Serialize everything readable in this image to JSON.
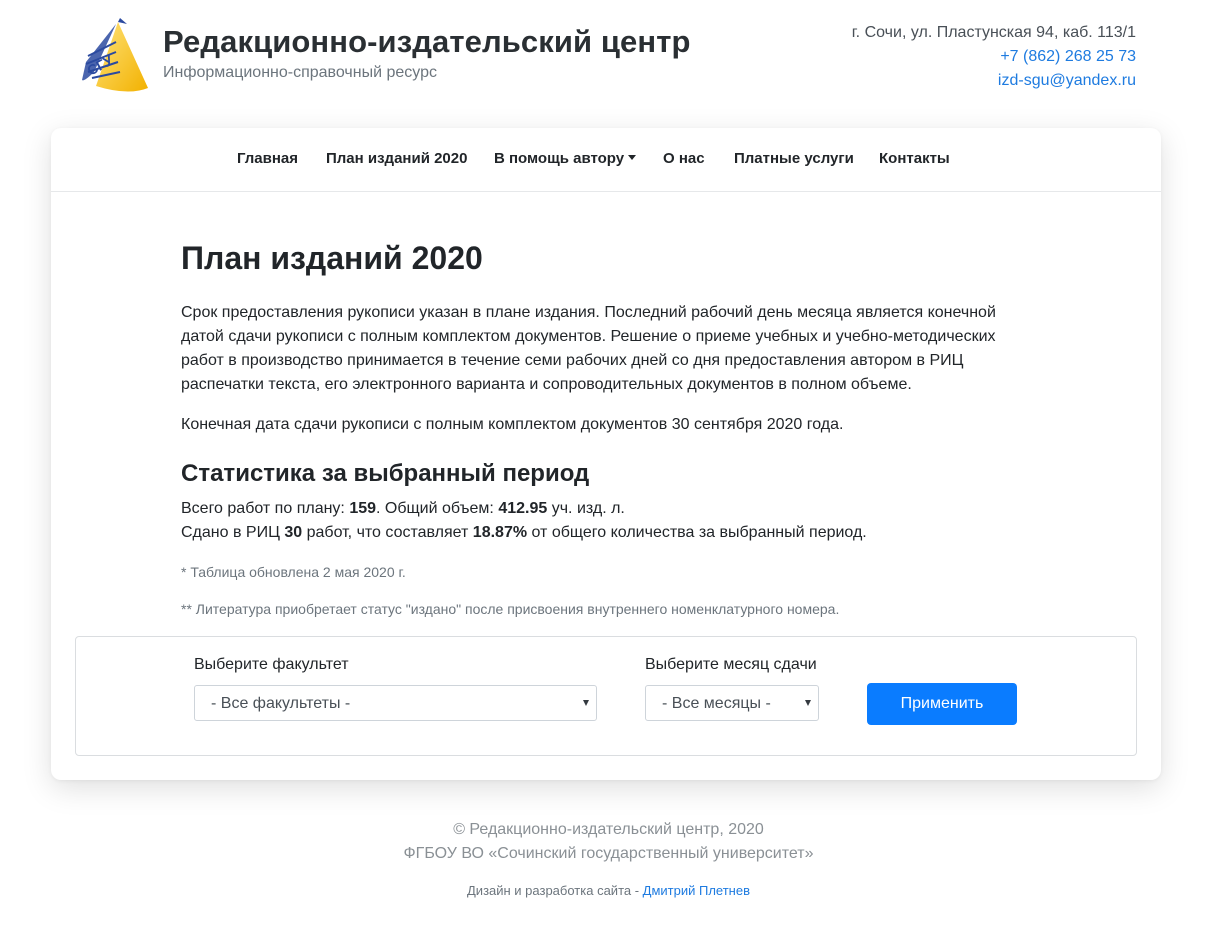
{
  "header": {
    "title": "Редакционно-издательский центр",
    "subtitle": "Информационно-справочный ресурс",
    "logo_text": "СГУ",
    "address": "г. Сочи, ул. Пластунская 94, каб. 113/1",
    "phone": "+7 (862) 268 25 73",
    "email": "izd-sgu@yandex.ru"
  },
  "nav": {
    "items": [
      {
        "label": "Главная"
      },
      {
        "label": "План изданий 2020"
      },
      {
        "label": "В помощь автору"
      },
      {
        "label": "О нас"
      },
      {
        "label": "Платные услуги"
      },
      {
        "label": "Контакты"
      }
    ]
  },
  "main": {
    "title": "План изданий 2020",
    "paragraph1": "Срок предоставления рукописи указан в плане издания. Последний рабочий день месяца является конечной датой сдачи рукописи с полным комплектом документов. Решение о приеме учебных и учебно-методических работ в производство принимается в течение семи рабочих дней со дня предоставления автором в РИЦ распечатки текста, его электронного варианта и сопроводительных документов в полном объеме.",
    "paragraph2": "Конечная дата сдачи рукописи с полным комплектом документов 30 сентября 2020 года.",
    "stats_title": "Статистика за выбранный период",
    "stats": {
      "line1_prefix": "Всего работ по плану: ",
      "total_works": "159",
      "line1_mid": ". Общий объем: ",
      "total_volume": "412.95",
      "line1_suffix": " уч. изд. л.",
      "line2_prefix": "Сдано в РИЦ ",
      "submitted": "30",
      "line2_mid": " работ, что составляет ",
      "percent": "18.87%",
      "line2_suffix": " от общего количества за выбранный период."
    },
    "note1": "* Таблица обновлена 2 мая 2020 г.",
    "note2": "** Литература приобретает статус \"издано\" после присвоения внутреннего номенклатурного номера."
  },
  "filter": {
    "faculty_label": "Выберите факультет",
    "faculty_value": "- Все факультеты -",
    "month_label": "Выберите месяц сдачи",
    "month_value": "- Все месяцы -",
    "apply_label": "Применить"
  },
  "footer": {
    "line1": "© Редакционно-издательский центр, 2020",
    "line2": "ФГБОУ ВО «Сочинский государственный университет»",
    "credit_prefix": "Дизайн и разработка сайта - ",
    "credit_name": "Дмитрий Плетнев"
  },
  "colors": {
    "accent": "#0a7cff",
    "link": "#1e7be0",
    "logo_yellow": "#f7c51e",
    "logo_blue": "#2b4aa0"
  }
}
